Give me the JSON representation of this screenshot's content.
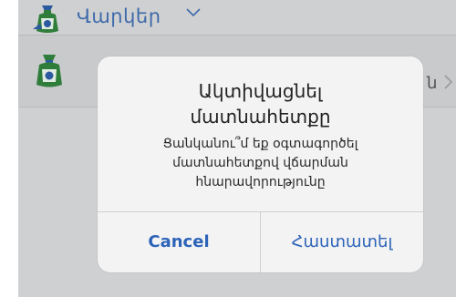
{
  "nav": {
    "title": "Վարկեր"
  },
  "row2": {
    "trailing_fragment": "ն"
  },
  "alert": {
    "title_line1": "Ակտիվացնել",
    "title_line2": "մատնահետքը",
    "message_line1": "Ցանկանու՞մ եք օգտագործել",
    "message_line2": "մատնահետքով վճարման",
    "message_line3": "հնարավորությունը",
    "cancel_label": "Cancel",
    "confirm_label": "Հաստատել"
  },
  "colors": {
    "accent": "#3e6aa9",
    "button": "#2c63b8",
    "bag_green": "#2f7d3a",
    "bag_blue": "#2c5aa0"
  }
}
